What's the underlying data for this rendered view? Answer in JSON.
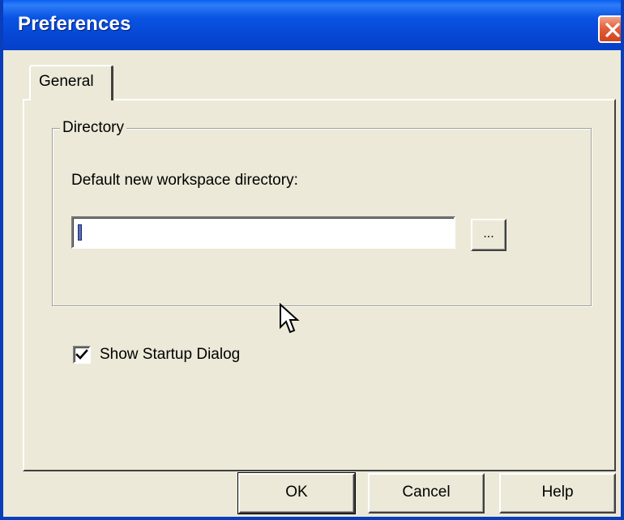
{
  "window": {
    "title": "Preferences",
    "close_icon": "close-icon"
  },
  "tabs": [
    {
      "label": "General",
      "active": true
    }
  ],
  "directory_group": {
    "legend": "Directory",
    "field_label": "Default new workspace directory:",
    "input_value": "",
    "browse_label": "..."
  },
  "startup": {
    "checkbox_label": "Show Startup Dialog",
    "checked": true
  },
  "buttons": {
    "ok": "OK",
    "cancel": "Cancel",
    "help": "Help"
  },
  "colors": {
    "titlebar": "#0a54e3",
    "dialog_bg": "#ece9d8",
    "close_button": "#e2603a"
  }
}
